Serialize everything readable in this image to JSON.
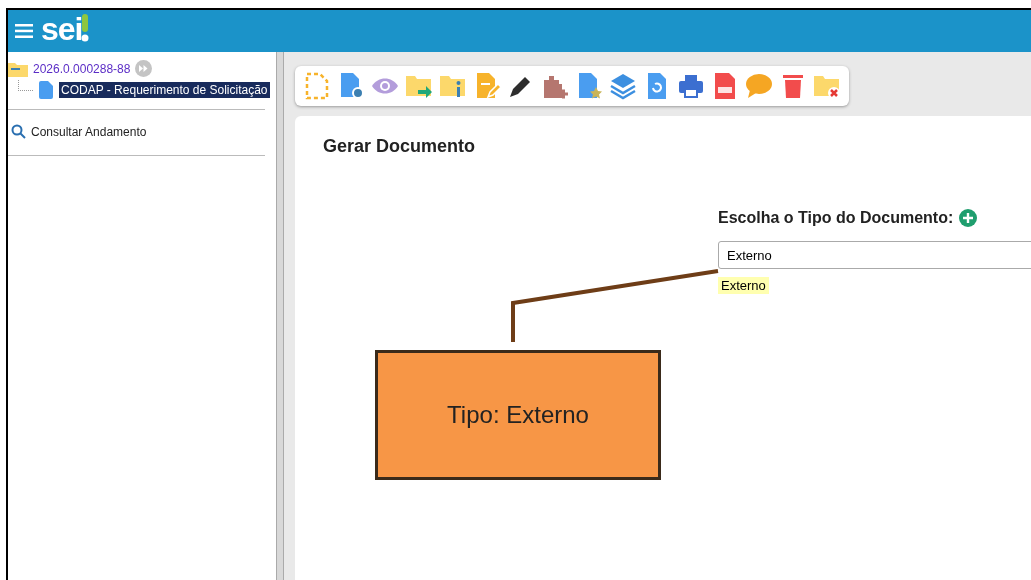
{
  "header": {
    "logo": "sei"
  },
  "tree": {
    "process": {
      "label": "2026.0.000288-88"
    },
    "documents": [
      {
        "label": "CODAP - Requerimento de Solicitação",
        "selected": true
      }
    ]
  },
  "sidebar": {
    "items": [
      {
        "label": "Consultar Andamento"
      }
    ]
  },
  "content": {
    "title": "Gerar Documento",
    "chooser": {
      "label": "Escolha o Tipo do Documento:",
      "value": "Externo",
      "suggestions": [
        {
          "label": "Externo",
          "highlighted": true
        }
      ]
    }
  },
  "callout": {
    "text": "Tipo: Externo"
  }
}
